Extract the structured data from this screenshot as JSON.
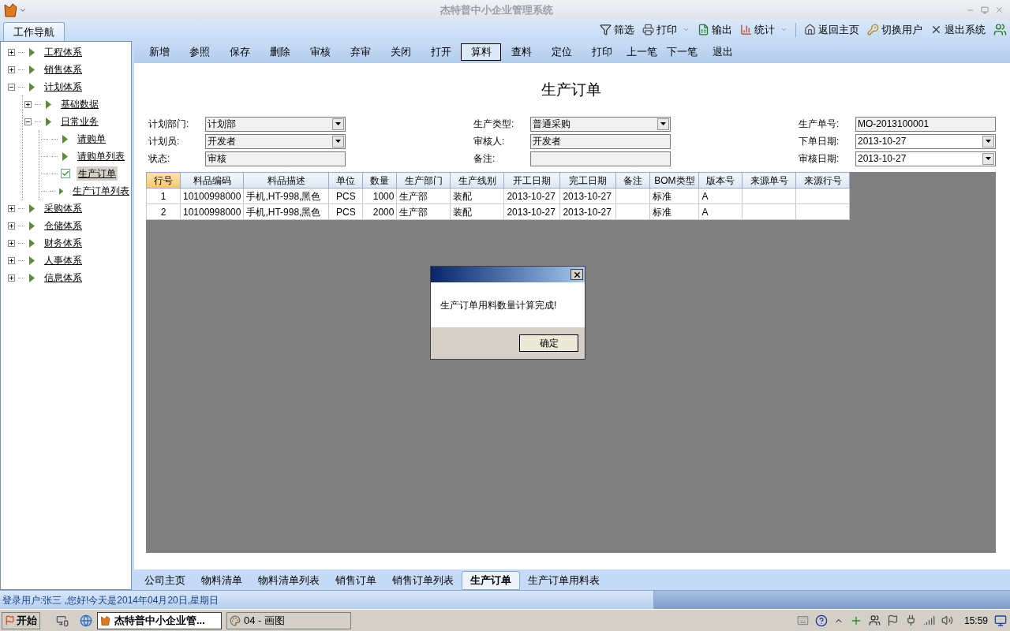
{
  "window": {
    "title": "杰特普中小企业管理系统"
  },
  "nav_tab": {
    "label": "工作导航",
    "selected": true
  },
  "top_toolbar": [
    {
      "label": "筛选",
      "kind": "filter",
      "dropdown": false
    },
    {
      "label": "打印",
      "kind": "print",
      "dropdown": true
    },
    {
      "label": "输出",
      "kind": "export",
      "dropdown": false
    },
    {
      "label": "统计",
      "kind": "stats",
      "dropdown": true
    },
    {
      "label": "返回主页",
      "kind": "home",
      "dropdown": false
    },
    {
      "label": "切换用户",
      "kind": "switch",
      "dropdown": false
    },
    {
      "label": "退出系统",
      "kind": "exit",
      "dropdown": false
    },
    {
      "kind": "users"
    }
  ],
  "tree": [
    {
      "label": "工程体系",
      "expanded": false,
      "selected": false
    },
    {
      "label": "销售体系",
      "expanded": false,
      "selected": false
    },
    {
      "label": "计划体系",
      "expanded": true,
      "selected": false,
      "children": [
        {
          "label": "基础数据",
          "expanded": false,
          "selected": false
        },
        {
          "label": "日常业务",
          "expanded": true,
          "selected": false,
          "children": [
            {
              "label": "请购单",
              "selected": false
            },
            {
              "label": "请购单列表",
              "selected": false
            },
            {
              "label": "生产订单",
              "selected": true
            },
            {
              "label": "生产订单列表",
              "selected": false
            }
          ]
        }
      ]
    },
    {
      "label": "采购体系",
      "expanded": false,
      "selected": false
    },
    {
      "label": "仓储体系",
      "expanded": false,
      "selected": false
    },
    {
      "label": "财务体系",
      "expanded": false,
      "selected": false
    },
    {
      "label": "人事体系",
      "expanded": false,
      "selected": false
    },
    {
      "label": "信息体系",
      "expanded": false,
      "selected": false
    }
  ],
  "toolbar": [
    {
      "label": "新增",
      "selected": false
    },
    {
      "label": "参照",
      "selected": false
    },
    {
      "label": "保存",
      "selected": false
    },
    {
      "label": "删除",
      "selected": false
    },
    {
      "label": "审核",
      "selected": false
    },
    {
      "label": "弃审",
      "selected": false
    },
    {
      "label": "关闭",
      "selected": false
    },
    {
      "label": "打开",
      "selected": false
    },
    {
      "label": "算料",
      "selected": true
    },
    {
      "label": "查料",
      "selected": false
    },
    {
      "label": "定位",
      "selected": false
    },
    {
      "label": "打印",
      "selected": false
    },
    {
      "label": "上一笔",
      "selected": false
    },
    {
      "label": "下一笔",
      "selected": false
    },
    {
      "label": "退出",
      "selected": false
    }
  ],
  "form": {
    "title": "生产订单",
    "columns": [
      [
        {
          "label": "计划部门:",
          "value": "计划部",
          "kind": "select"
        },
        {
          "label": "计划员:",
          "value": "开发者",
          "kind": "select"
        },
        {
          "label": "状态:",
          "value": "审核",
          "kind": "text"
        }
      ],
      [
        {
          "label": "生产类型:",
          "value": "普通采购",
          "kind": "select"
        },
        {
          "label": "审核人:",
          "value": "开发者",
          "kind": "text"
        },
        {
          "label": "备注:",
          "kind": "text"
        }
      ],
      [
        {
          "label": "生产单号:",
          "value": "MO-2013100001",
          "kind": "text"
        },
        {
          "label": "下单日期:",
          "value": "2013-10-27",
          "kind": "date"
        },
        {
          "label": "审核日期:",
          "value": "2013-10-27",
          "kind": "date"
        }
      ]
    ]
  },
  "table": {
    "columns": [
      "行号",
      "料品编码",
      "料品描述",
      "单位",
      "数量",
      "生产部门",
      "生产线别",
      "开工日期",
      "完工日期",
      "备注",
      "BOM类型",
      "版本号",
      "来源单号",
      "来源行号"
    ],
    "rows": [
      [
        "1",
        "10100998000",
        "手机,HT-998,黑色",
        "PCS",
        "1000",
        "生产部",
        "装配",
        "2013-10-27",
        "2013-10-27",
        "",
        "标准",
        "A",
        "",
        ""
      ],
      [
        "2",
        "10100998000",
        "手机,HT-998,黑色",
        "PCS",
        "2000",
        "生产部",
        "装配",
        "2013-10-27",
        "2013-10-27",
        "",
        "标准",
        "A",
        "",
        ""
      ]
    ]
  },
  "dialog": {
    "message": "生产订单用料数量计算完成!",
    "button": "确定"
  },
  "bottom_tabs": [
    {
      "label": "公司主页",
      "selected": false
    },
    {
      "label": "物料清单",
      "selected": false
    },
    {
      "label": "物料清单列表",
      "selected": false
    },
    {
      "label": "销售订单",
      "selected": false
    },
    {
      "label": "销售订单列表",
      "selected": false
    },
    {
      "label": "生产订单",
      "selected": true
    },
    {
      "label": "生产订单用料表",
      "selected": false
    }
  ],
  "status_bar": "登录用户:张三 ,您好!今天是2014年04月20日,星期日",
  "taskbar": {
    "start": "开始",
    "windows": [
      {
        "label": "杰特普中小企业管...",
        "selected": true
      },
      {
        "label": "04 - 画图",
        "selected": false
      }
    ],
    "clock": "15:59"
  }
}
